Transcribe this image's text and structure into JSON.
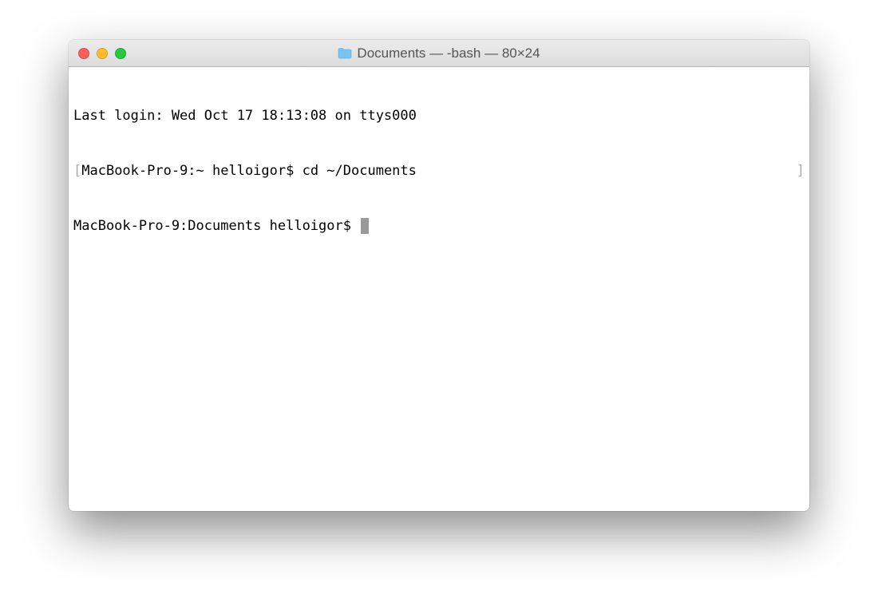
{
  "window": {
    "title": "Documents — -bash — 80×24"
  },
  "terminal": {
    "lines": [
      {
        "text": "Last login: Wed Oct 17 18:13:08 on ttys000",
        "wrapped": false
      },
      {
        "prompt": "MacBook-Pro-9:~ helloigor$ ",
        "command": "cd ~/Documents",
        "wrapped": true
      },
      {
        "prompt": "MacBook-Pro-9:Documents helloigor$ ",
        "command": "",
        "cursor": true,
        "wrapped": false
      }
    ]
  }
}
